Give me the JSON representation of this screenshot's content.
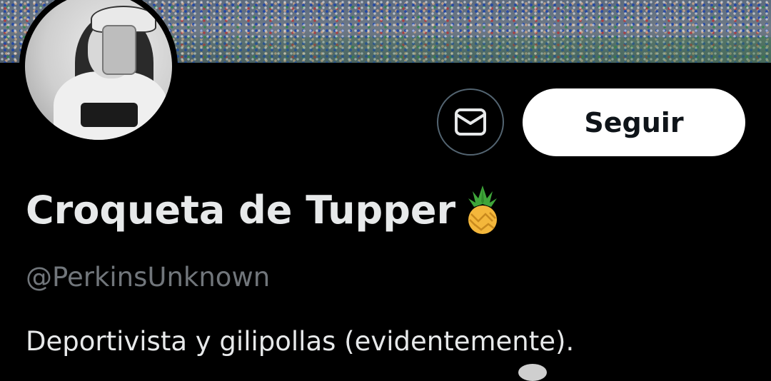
{
  "profile": {
    "display_name": "Croqueta de Tupper",
    "name_emoji": "pineapple-emoji",
    "handle": "@PerkinsUnknown",
    "bio": "Deportivista y gilipollas (evidentemente)."
  },
  "actions": {
    "message_icon": "envelope-icon",
    "follow_label": "Seguir"
  },
  "colors": {
    "background": "#000000",
    "primary_text": "#e7e9ea",
    "secondary_text": "#71767b",
    "button_border": "#536471",
    "follow_bg": "#ffffff",
    "follow_text": "#0f1419"
  }
}
